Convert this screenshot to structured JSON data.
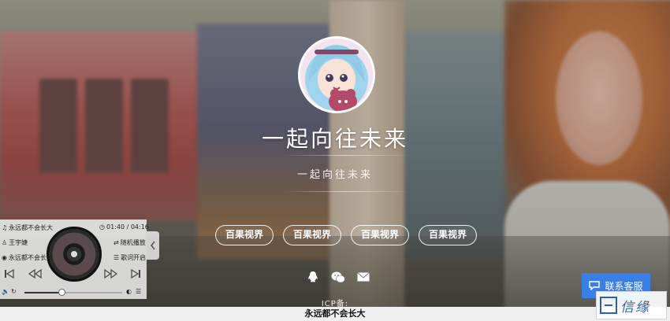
{
  "site": {
    "title": "一起向往未来",
    "subtitle": "一起向往未来"
  },
  "links": [
    {
      "label": "百果视界"
    },
    {
      "label": "百果视界"
    },
    {
      "label": "百果视界"
    },
    {
      "label": "百果视界"
    }
  ],
  "socials": [
    {
      "icon": "qq-icon"
    },
    {
      "icon": "wechat-icon"
    },
    {
      "icon": "mail-icon"
    }
  ],
  "footer": {
    "icp": "ICP备:",
    "slogan": "永远都不会长大"
  },
  "service": {
    "label": "联系客服",
    "accent": "#3a7fe6"
  },
  "watermark": {
    "text": "信缘"
  },
  "player": {
    "song_title": "永远都不会长大",
    "time": "01:40 / 04:16",
    "artist": "王宇婕",
    "loop_mode": "随机播放",
    "album": "永远都不会长大",
    "lyric_toggle": "歌词开启",
    "progress": 0.38
  }
}
